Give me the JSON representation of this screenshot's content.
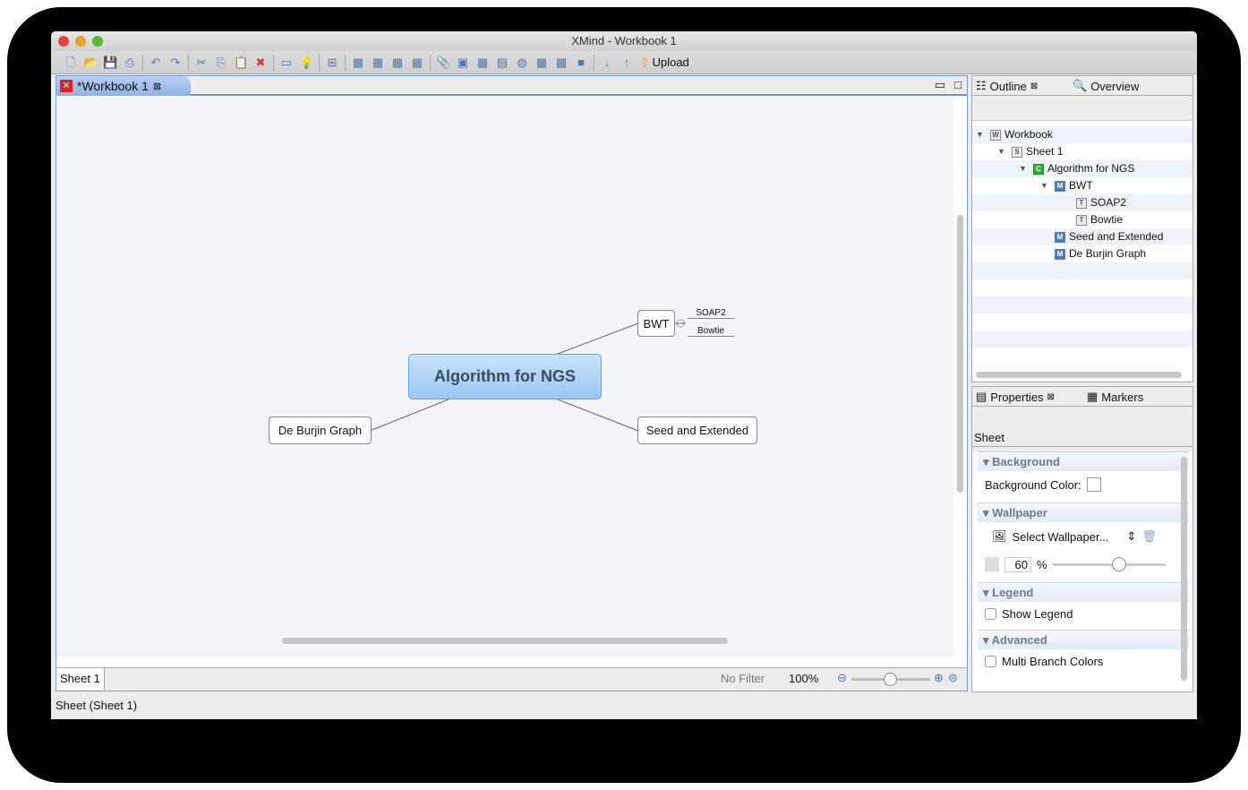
{
  "window": {
    "title": "XMind - Workbook 1"
  },
  "toolbar": {
    "upload_label": "Upload",
    "icons": [
      "new-icon",
      "open-icon",
      "save-icon",
      "print-icon",
      "undo-icon",
      "redo-icon",
      "cut-icon",
      "copy-icon",
      "paste-icon",
      "delete-icon",
      "presentation-icon",
      "idea-icon",
      "new-sheet-icon",
      "topic-icon",
      "subtopic-icon",
      "callout-icon",
      "floating-topic-icon",
      "attachment-icon",
      "image-icon",
      "boundary-icon",
      "note-icon",
      "hyperlink-icon",
      "summary-icon",
      "relationship-icon",
      "stop-icon",
      "drill-down-icon",
      "drill-up-icon"
    ]
  },
  "editor": {
    "tab_label": "*Workbook 1",
    "sheet_tab": "Sheet 1",
    "filter": "No Filter",
    "zoom": "100%",
    "zoom_slider_percent": 50
  },
  "map": {
    "central": "Algorithm for NGS",
    "topics": [
      "BWT",
      "Seed and Extended",
      "De Burjin Graph"
    ],
    "subtopics": [
      "SOAP2",
      "Bowtie"
    ]
  },
  "outline": {
    "tab": "Outline",
    "tab2": "Overview",
    "tree": [
      {
        "label": "Workbook",
        "icon": "W"
      },
      {
        "label": "Sheet 1",
        "icon": "S"
      },
      {
        "label": "Algorithm for NGS",
        "icon": "C"
      },
      {
        "label": "BWT",
        "icon": "M"
      },
      {
        "label": "SOAP2",
        "icon": "T"
      },
      {
        "label": "Bowtie",
        "icon": "T"
      },
      {
        "label": "Seed and Extended",
        "icon": "M"
      },
      {
        "label": "De Burjin Graph",
        "icon": "M"
      }
    ]
  },
  "properties": {
    "tab": "Properties",
    "tab2": "Markers",
    "title": "Sheet",
    "background": "Background",
    "bg_color_label": "Background Color:",
    "wallpaper": "Wallpaper",
    "select_wallpaper": "Select Wallpaper...",
    "opacity": "60",
    "percent": "%",
    "opacity_slider_percent": 60,
    "legend": "Legend",
    "show_legend": "Show Legend",
    "advanced": "Advanced",
    "multi_branch": "Multi Branch Colors"
  },
  "status": {
    "text": "Sheet (Sheet 1)"
  }
}
